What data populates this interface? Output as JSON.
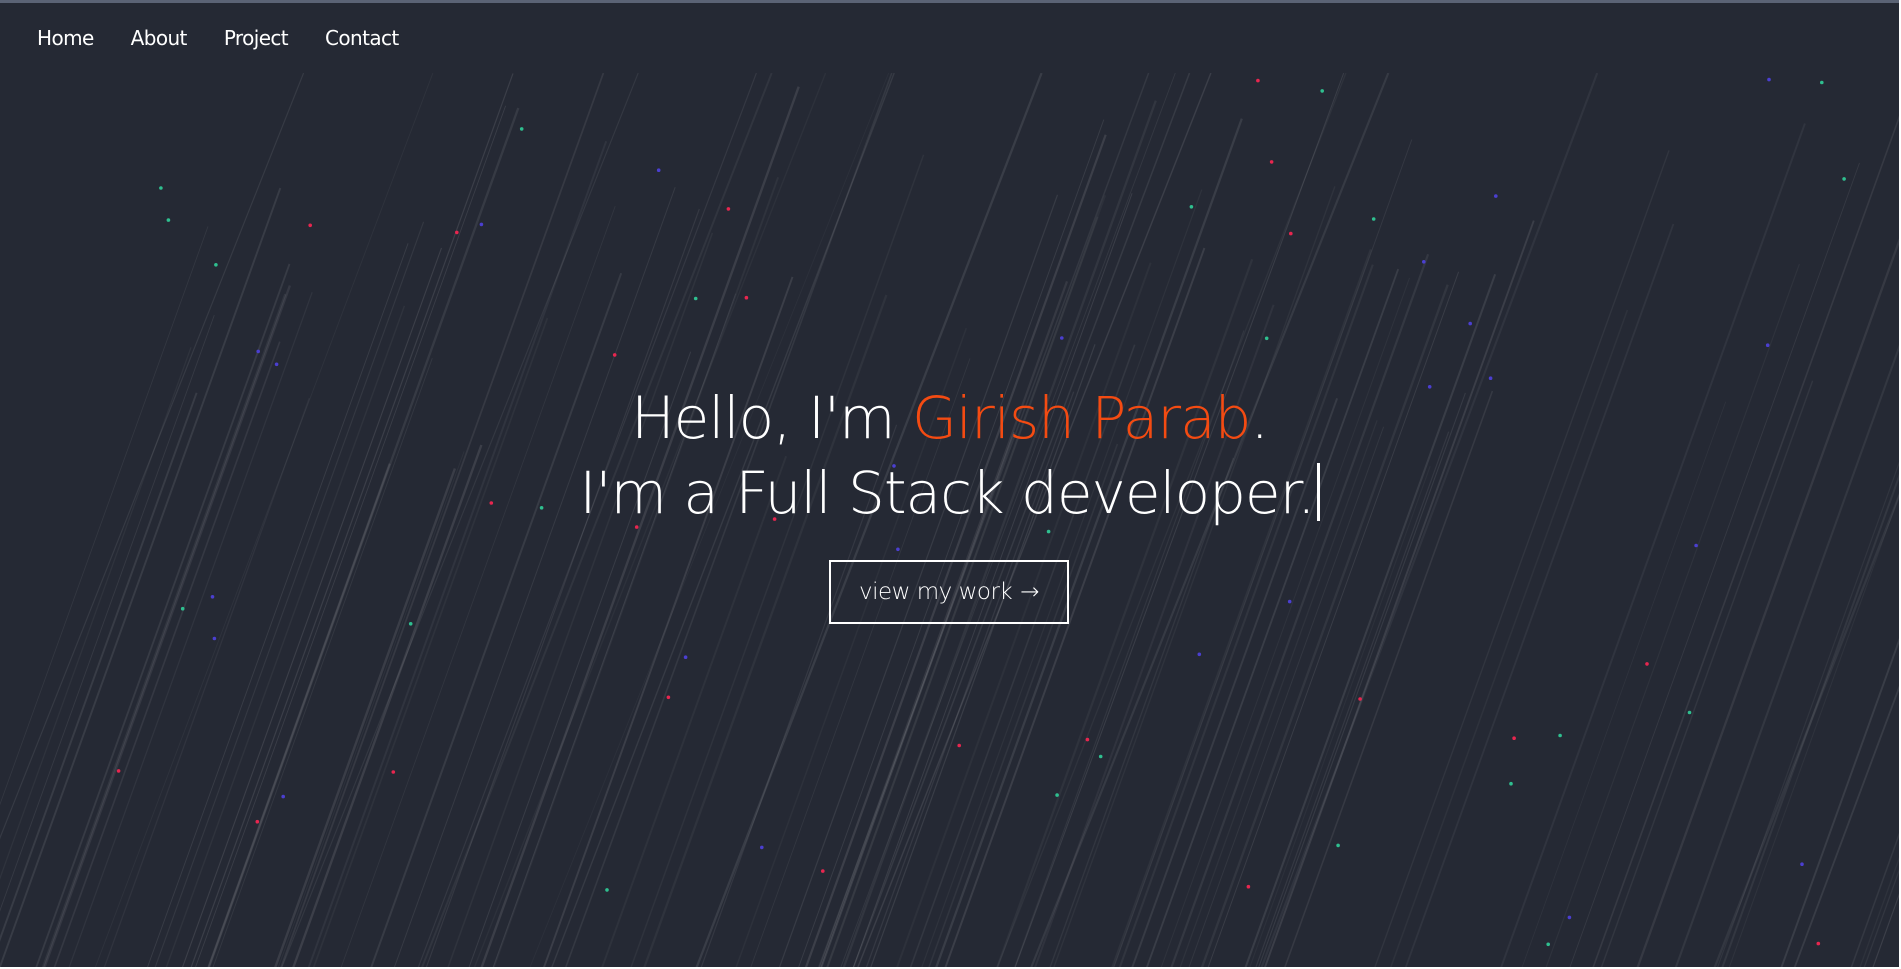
{
  "nav": {
    "items": [
      {
        "label": "Home"
      },
      {
        "label": "About"
      },
      {
        "label": "Project"
      },
      {
        "label": "Contact"
      }
    ]
  },
  "hero": {
    "greeting": "Hello, I'm ",
    "name": "Girish Parab",
    "period": ".",
    "tagline": "I'm a Full Stack developer.",
    "cta_label": "view my work",
    "cta_arrow": "→"
  },
  "colors": {
    "background": "#252934",
    "accent": "#f44b12",
    "text": "#ffffff",
    "particle_blue": "#4b3fd0",
    "particle_red": "#e8264f",
    "particle_green": "#2fbf8f"
  }
}
